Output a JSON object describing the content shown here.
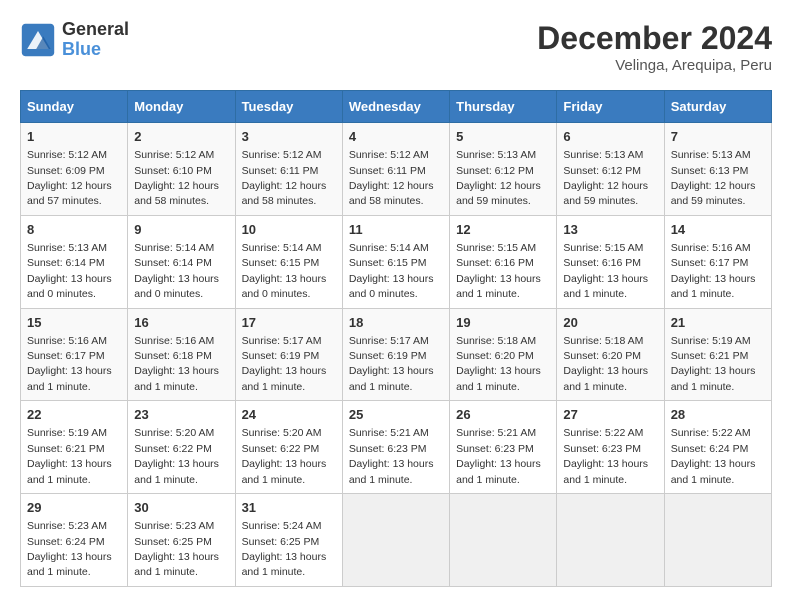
{
  "header": {
    "logo_line1": "General",
    "logo_line2": "Blue",
    "title": "December 2024",
    "subtitle": "Velinga, Arequipa, Peru"
  },
  "days_of_week": [
    "Sunday",
    "Monday",
    "Tuesday",
    "Wednesday",
    "Thursday",
    "Friday",
    "Saturday"
  ],
  "weeks": [
    [
      {
        "day": 1,
        "info": "Sunrise: 5:12 AM\nSunset: 6:09 PM\nDaylight: 12 hours\nand 57 minutes."
      },
      {
        "day": 2,
        "info": "Sunrise: 5:12 AM\nSunset: 6:10 PM\nDaylight: 12 hours\nand 58 minutes."
      },
      {
        "day": 3,
        "info": "Sunrise: 5:12 AM\nSunset: 6:11 PM\nDaylight: 12 hours\nand 58 minutes."
      },
      {
        "day": 4,
        "info": "Sunrise: 5:12 AM\nSunset: 6:11 PM\nDaylight: 12 hours\nand 58 minutes."
      },
      {
        "day": 5,
        "info": "Sunrise: 5:13 AM\nSunset: 6:12 PM\nDaylight: 12 hours\nand 59 minutes."
      },
      {
        "day": 6,
        "info": "Sunrise: 5:13 AM\nSunset: 6:12 PM\nDaylight: 12 hours\nand 59 minutes."
      },
      {
        "day": 7,
        "info": "Sunrise: 5:13 AM\nSunset: 6:13 PM\nDaylight: 12 hours\nand 59 minutes."
      }
    ],
    [
      {
        "day": 8,
        "info": "Sunrise: 5:13 AM\nSunset: 6:14 PM\nDaylight: 13 hours\nand 0 minutes."
      },
      {
        "day": 9,
        "info": "Sunrise: 5:14 AM\nSunset: 6:14 PM\nDaylight: 13 hours\nand 0 minutes."
      },
      {
        "day": 10,
        "info": "Sunrise: 5:14 AM\nSunset: 6:15 PM\nDaylight: 13 hours\nand 0 minutes."
      },
      {
        "day": 11,
        "info": "Sunrise: 5:14 AM\nSunset: 6:15 PM\nDaylight: 13 hours\nand 0 minutes."
      },
      {
        "day": 12,
        "info": "Sunrise: 5:15 AM\nSunset: 6:16 PM\nDaylight: 13 hours\nand 1 minute."
      },
      {
        "day": 13,
        "info": "Sunrise: 5:15 AM\nSunset: 6:16 PM\nDaylight: 13 hours\nand 1 minute."
      },
      {
        "day": 14,
        "info": "Sunrise: 5:16 AM\nSunset: 6:17 PM\nDaylight: 13 hours\nand 1 minute."
      }
    ],
    [
      {
        "day": 15,
        "info": "Sunrise: 5:16 AM\nSunset: 6:17 PM\nDaylight: 13 hours\nand 1 minute."
      },
      {
        "day": 16,
        "info": "Sunrise: 5:16 AM\nSunset: 6:18 PM\nDaylight: 13 hours\nand 1 minute."
      },
      {
        "day": 17,
        "info": "Sunrise: 5:17 AM\nSunset: 6:19 PM\nDaylight: 13 hours\nand 1 minute."
      },
      {
        "day": 18,
        "info": "Sunrise: 5:17 AM\nSunset: 6:19 PM\nDaylight: 13 hours\nand 1 minute."
      },
      {
        "day": 19,
        "info": "Sunrise: 5:18 AM\nSunset: 6:20 PM\nDaylight: 13 hours\nand 1 minute."
      },
      {
        "day": 20,
        "info": "Sunrise: 5:18 AM\nSunset: 6:20 PM\nDaylight: 13 hours\nand 1 minute."
      },
      {
        "day": 21,
        "info": "Sunrise: 5:19 AM\nSunset: 6:21 PM\nDaylight: 13 hours\nand 1 minute."
      }
    ],
    [
      {
        "day": 22,
        "info": "Sunrise: 5:19 AM\nSunset: 6:21 PM\nDaylight: 13 hours\nand 1 minute."
      },
      {
        "day": 23,
        "info": "Sunrise: 5:20 AM\nSunset: 6:22 PM\nDaylight: 13 hours\nand 1 minute."
      },
      {
        "day": 24,
        "info": "Sunrise: 5:20 AM\nSunset: 6:22 PM\nDaylight: 13 hours\nand 1 minute."
      },
      {
        "day": 25,
        "info": "Sunrise: 5:21 AM\nSunset: 6:23 PM\nDaylight: 13 hours\nand 1 minute."
      },
      {
        "day": 26,
        "info": "Sunrise: 5:21 AM\nSunset: 6:23 PM\nDaylight: 13 hours\nand 1 minute."
      },
      {
        "day": 27,
        "info": "Sunrise: 5:22 AM\nSunset: 6:23 PM\nDaylight: 13 hours\nand 1 minute."
      },
      {
        "day": 28,
        "info": "Sunrise: 5:22 AM\nSunset: 6:24 PM\nDaylight: 13 hours\nand 1 minute."
      }
    ],
    [
      {
        "day": 29,
        "info": "Sunrise: 5:23 AM\nSunset: 6:24 PM\nDaylight: 13 hours\nand 1 minute."
      },
      {
        "day": 30,
        "info": "Sunrise: 5:23 AM\nSunset: 6:25 PM\nDaylight: 13 hours\nand 1 minute."
      },
      {
        "day": 31,
        "info": "Sunrise: 5:24 AM\nSunset: 6:25 PM\nDaylight: 13 hours\nand 1 minute."
      },
      null,
      null,
      null,
      null
    ]
  ]
}
